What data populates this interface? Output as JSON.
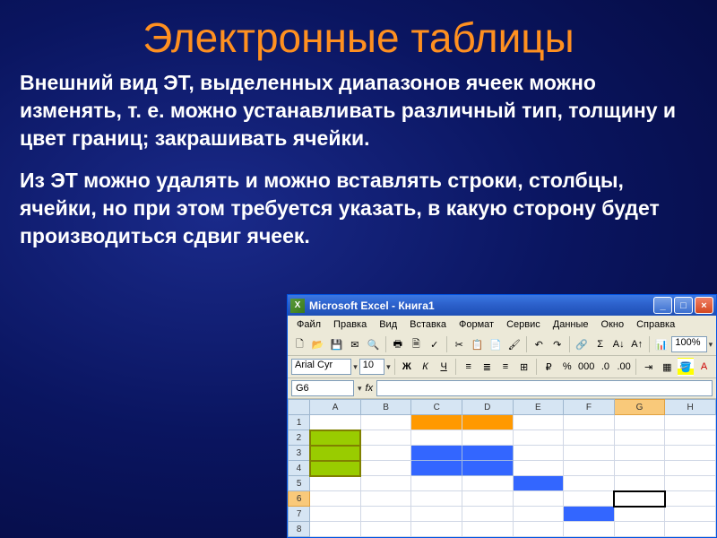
{
  "slide": {
    "title": "Электронные таблицы",
    "para1": "Внешний вид ЭТ, выделенных диапазонов ячеек можно изменять, т. е. можно устанавливать различный тип, толщину и цвет границ; закрашивать ячейки.",
    "para2": "Из ЭТ можно удалять и можно вставлять строки, столбцы, ячейки, но при этом требуется указать, в какую сторону будет производиться сдвиг ячеек."
  },
  "excel": {
    "titlebar": "Microsoft Excel - Книга1",
    "menus": [
      "Файл",
      "Правка",
      "Вид",
      "Вставка",
      "Формат",
      "Сервис",
      "Данные",
      "Окно",
      "Справка"
    ],
    "zoom": "100%",
    "font": "Arial Cyr",
    "fontsize": "10",
    "namebox": "G6",
    "fx": "fx",
    "columns": [
      "A",
      "B",
      "C",
      "D",
      "E",
      "F",
      "G",
      "H"
    ],
    "rows": [
      "1",
      "2",
      "3",
      "4",
      "5",
      "6",
      "7",
      "8"
    ],
    "selected_cell": "G6",
    "cell_fills": {
      "orange": [
        "C1",
        "D1"
      ],
      "olive": [
        "A2",
        "A3",
        "A4"
      ],
      "blue": [
        "C3",
        "D3",
        "C4",
        "D4",
        "E5",
        "F7"
      ]
    }
  }
}
